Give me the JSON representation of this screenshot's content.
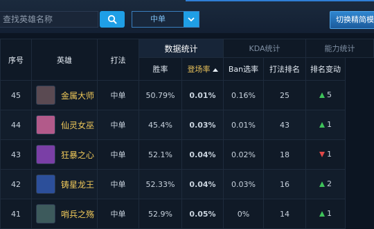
{
  "search": {
    "placeholder": "查找英雄名称"
  },
  "filter": {
    "selected": "中单"
  },
  "switch_button": "切换精简模式",
  "tabs": [
    "数据统计",
    "KDA统计",
    "能力统计"
  ],
  "headers": {
    "rank": "序号",
    "hero": "英雄",
    "role": "打法",
    "win_rate": "胜率",
    "appear_rate": "登场率",
    "ban_rate": "Ban选率",
    "role_rank": "打法排名",
    "rank_change": "排名变动"
  },
  "rows": [
    {
      "rank": "45",
      "hero": "金属大师",
      "role": "中单",
      "win_rate": "50.79%",
      "appear_rate": "0.01%",
      "ban_rate": "0.16%",
      "role_rank": "25",
      "change_dir": "up",
      "change": "5",
      "avatar_color": "#5a4a52"
    },
    {
      "rank": "44",
      "hero": "仙灵女巫",
      "role": "中单",
      "win_rate": "45.4%",
      "appear_rate": "0.03%",
      "ban_rate": "0.01%",
      "role_rank": "43",
      "change_dir": "up",
      "change": "1",
      "avatar_color": "#b25a8a"
    },
    {
      "rank": "43",
      "hero": "狂暴之心",
      "role": "中单",
      "win_rate": "52.1%",
      "appear_rate": "0.04%",
      "ban_rate": "0.02%",
      "role_rank": "18",
      "change_dir": "down",
      "change": "1",
      "avatar_color": "#7a3fa6"
    },
    {
      "rank": "42",
      "hero": "铸星龙王",
      "role": "中单",
      "win_rate": "52.33%",
      "appear_rate": "0.04%",
      "ban_rate": "0.03%",
      "role_rank": "16",
      "change_dir": "up",
      "change": "2",
      "avatar_color": "#2c4f9a"
    },
    {
      "rank": "41",
      "hero": "哨兵之殇",
      "role": "中单",
      "win_rate": "52.9%",
      "appear_rate": "0.05%",
      "ban_rate": "0%",
      "role_rank": "14",
      "change_dir": "up",
      "change": "1",
      "avatar_color": "#3d5a5c"
    }
  ],
  "colors": {
    "accent": "#1f9fe6",
    "highlight": "#f0c95a",
    "up": "#3ec35a",
    "down": "#e04848"
  }
}
